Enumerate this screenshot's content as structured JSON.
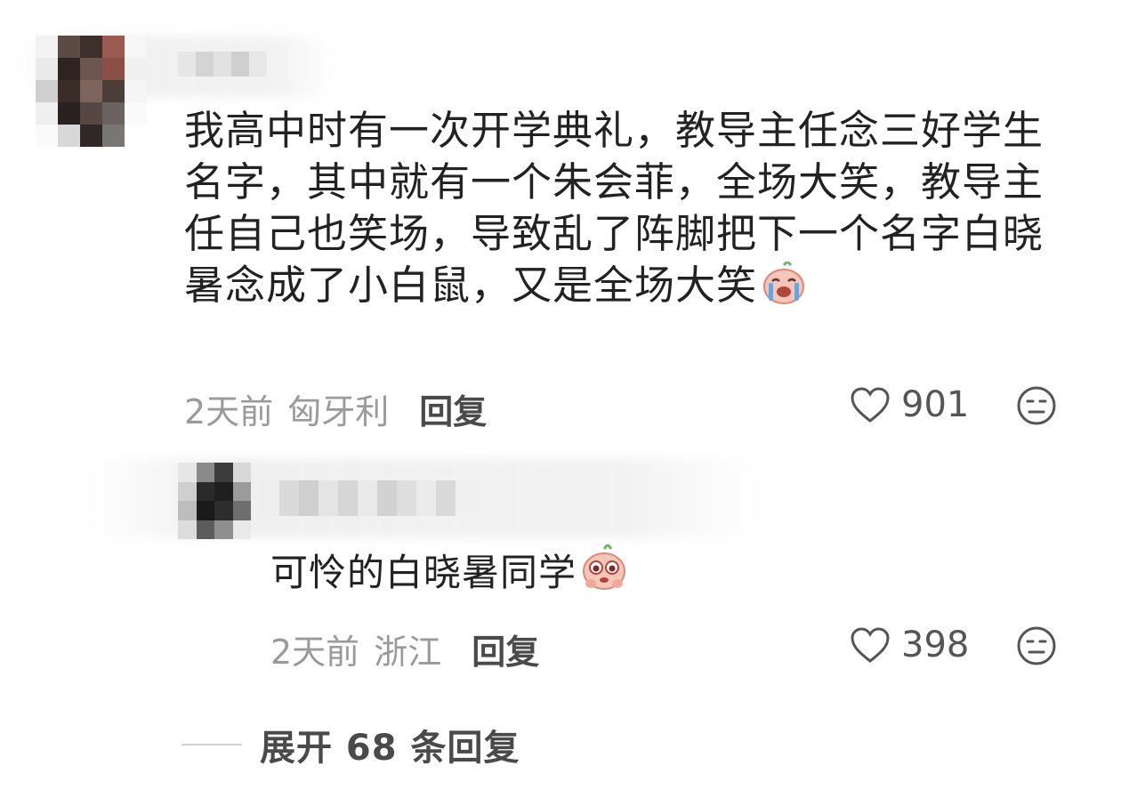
{
  "comment": {
    "text": "我高中时有一次开学典礼，教导主任念三好学生名字，其中就有一个朱会菲，全场大笑，教导主任自己也笑场，导致乱了阵脚把下一个名字白晓暑念成了小白鼠，又是全场大笑",
    "emoji": "laugh-crying-emoji",
    "time": "2天前",
    "location": "匈牙利",
    "reply_label": "回复",
    "likes": "901",
    "dislike_icon": "meh-face-icon"
  },
  "reply": {
    "text": "可怜的白晓暑同学",
    "emoji": "teary-eyed-emoji",
    "time": "2天前",
    "location": "浙江",
    "reply_label": "回复",
    "likes": "398",
    "dislike_icon": "meh-face-icon"
  },
  "expand": {
    "label": "展开 68 条回复"
  },
  "colors": {
    "text": "#222222",
    "meta": "#9a9a9a",
    "action": "#4a4a4a"
  }
}
